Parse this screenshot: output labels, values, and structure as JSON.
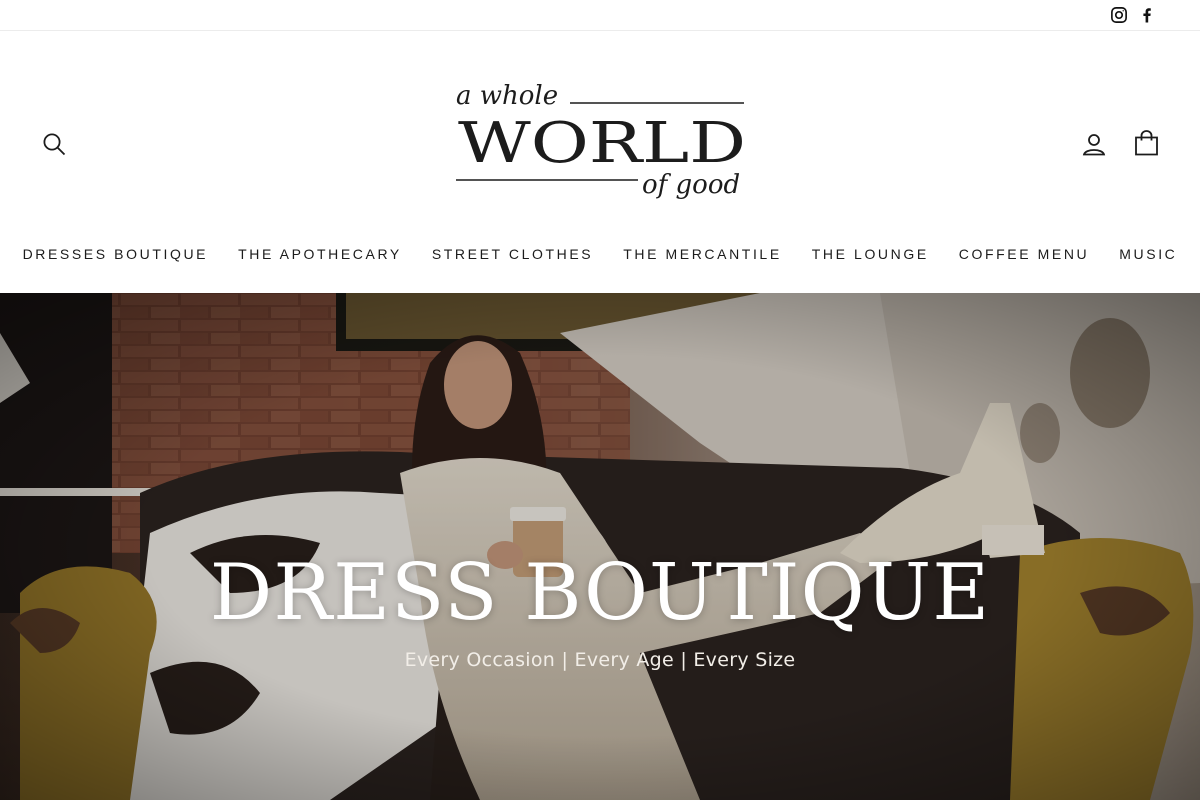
{
  "social": {
    "instagram_icon": "instagram-icon",
    "facebook_icon": "facebook-icon"
  },
  "header": {
    "search_icon": "search-icon",
    "account_icon": "user-icon",
    "cart_icon": "shopping-bag-icon",
    "logo": {
      "line1": "a whole",
      "line2": "WORLD",
      "line3": "of good"
    }
  },
  "nav": {
    "items": [
      {
        "label": "DRESSES BOUTIQUE"
      },
      {
        "label": "THE APOTHECARY"
      },
      {
        "label": "STREET CLOTHES"
      },
      {
        "label": "THE MERCANTILE"
      },
      {
        "label": "THE LOUNGE"
      },
      {
        "label": "COFFEE MENU"
      },
      {
        "label": "MUSIC"
      }
    ]
  },
  "hero": {
    "title": "DRESS BOUTIQUE",
    "subtitle": "Every Occasion | Every Age | Every Size",
    "image_alt": "woman in white dress sitting on a sofa holding a coffee cup"
  },
  "colors": {
    "text": "#1c1c1c",
    "background": "#ffffff",
    "hero_text": "#ffffff"
  }
}
